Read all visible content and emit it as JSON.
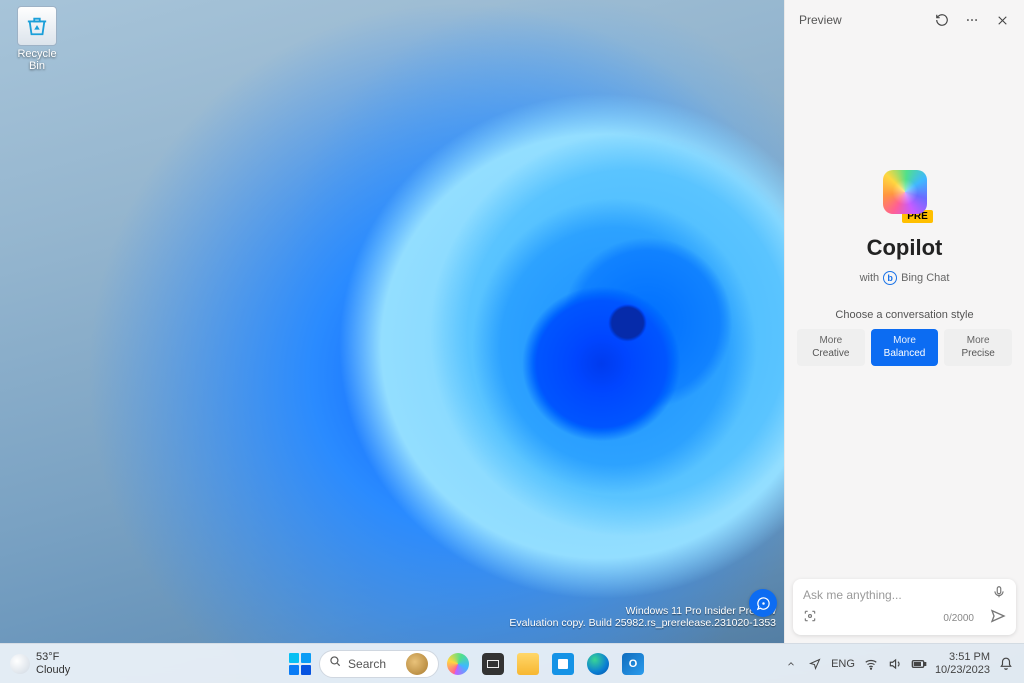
{
  "desktop": {
    "recycle_bin_label": "Recycle Bin",
    "watermark_line1": "Windows 11 Pro Insider Preview",
    "watermark_line2": "Evaluation copy. Build 25982.rs_prerelease.231020-1353"
  },
  "copilot": {
    "header_title": "Preview",
    "logo_badge": "PRE",
    "heading": "Copilot",
    "with_prefix": "with",
    "with_brand": "Bing Chat",
    "style_label": "Choose a conversation style",
    "styles": [
      {
        "word1": "More",
        "word2": "Creative",
        "active": false
      },
      {
        "word1": "More",
        "word2": "Balanced",
        "active": true
      },
      {
        "word1": "More",
        "word2": "Precise",
        "active": false
      }
    ],
    "input_placeholder": "Ask me anything...",
    "char_counter": "0/2000"
  },
  "taskbar": {
    "weather_temp": "53°F",
    "weather_cond": "Cloudy",
    "search_label": "Search",
    "lang": "ENG",
    "time": "3:51 PM",
    "date": "10/23/2023"
  },
  "colors": {
    "accent": "#0c6cf2",
    "panel_bg": "#f6f5f5"
  }
}
